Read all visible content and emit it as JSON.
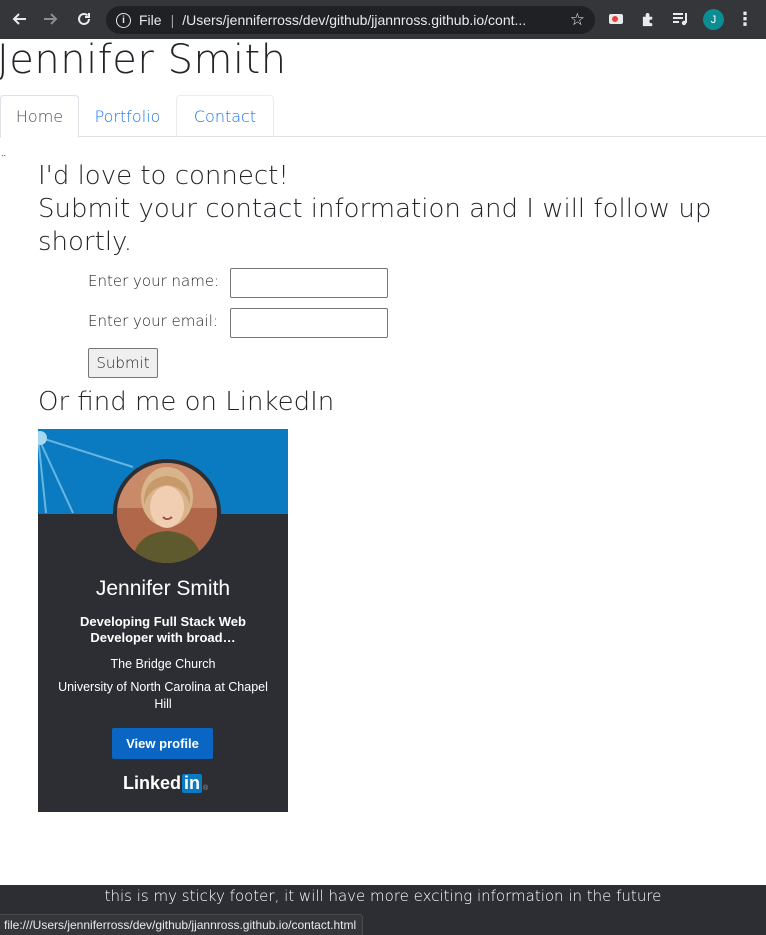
{
  "browser": {
    "scheme_label": "File",
    "url": "/Users/jenniferross/dev/github/jjannross.github.io/cont...",
    "profile_initial": "J",
    "status_url": "file:///Users/jenniferross/dev/github/jjannross.github.io/contact.html"
  },
  "site": {
    "title": "Jennifer Smith",
    "tabs": [
      {
        "label": "Home",
        "active": true
      },
      {
        "label": "Portfolio",
        "active": false
      },
      {
        "label": "Contact",
        "active": false
      }
    ],
    "stray_mark": ".."
  },
  "contact": {
    "heading_line1": "I'd love to connect!",
    "heading_line2": "Submit your contact information and I will follow up shortly.",
    "name_label": "Enter your name:",
    "name_value": "",
    "email_label": "Enter your email:",
    "email_value": "",
    "submit_label": "Submit",
    "linkedin_heading": "Or find me on LinkedIn"
  },
  "badge": {
    "name": "Jennifer Smith",
    "headline": "Developing Full Stack Web Developer with broad…",
    "company": "The Bridge Church",
    "school": "University of North Carolina at Chapel Hill",
    "button_label": "View profile",
    "logo_text": "Linked",
    "logo_in": "in",
    "banner_color": "#0a7bc1",
    "card_color": "#2c2e33"
  },
  "footer": {
    "text": "this is my sticky footer, it will have more exciting information in the future"
  },
  "colors": {
    "link": "#1a73e8",
    "chrome": "#35363a",
    "linkedin_blue": "#0a66c2"
  }
}
